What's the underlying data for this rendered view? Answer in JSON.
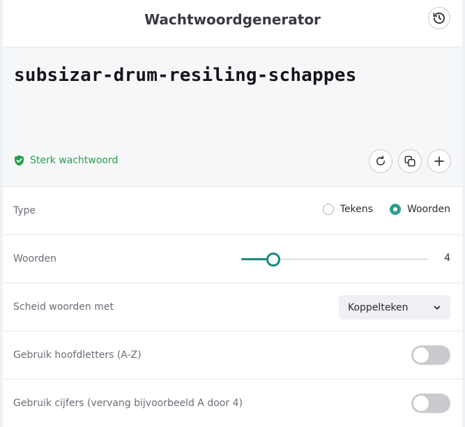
{
  "header": {
    "title": "Wachtwoordgenerator",
    "history_icon": "history-icon"
  },
  "password": {
    "value": "subsizar-drum-resiling-schappes",
    "strength_label": "Sterk wachtwoord",
    "strength_color": "#24a148"
  },
  "actions": [
    {
      "name": "regenerate",
      "icon": "refresh-icon"
    },
    {
      "name": "copy",
      "icon": "copy-icon"
    },
    {
      "name": "add",
      "icon": "plus-icon"
    }
  ],
  "settings": {
    "type": {
      "label": "Type",
      "options": [
        "Tekens",
        "Woorden"
      ],
      "selected": "Woorden"
    },
    "words": {
      "label": "Woorden",
      "value": "4",
      "slider_fraction": 0.17
    },
    "separator": {
      "label": "Scheid woorden met",
      "value": "Koppelteken"
    },
    "capitalize": {
      "label": "Gebruik hoofdletters (A-Z)",
      "enabled": false
    },
    "numbers": {
      "label": "Gebruik cijfers (vervang bijvoorbeeld A door 4)",
      "enabled": false
    }
  },
  "colors": {
    "accent": "#168a7f",
    "radio_selected": "#2a9d90",
    "toggle_off": "#c9cbcf"
  }
}
